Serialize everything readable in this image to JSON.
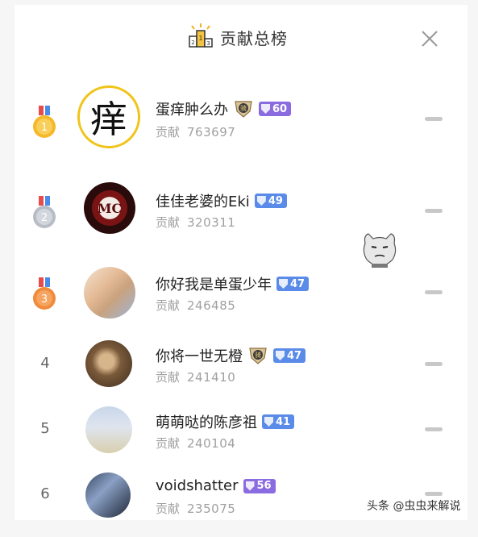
{
  "header": {
    "title": "贡献总榜"
  },
  "contribution_label": "贡献",
  "rows": [
    {
      "rank": "1",
      "name": "蛋痒肿么办",
      "has_vip": true,
      "level": "60",
      "badge_color": "#8b6be0",
      "contribution": "763697",
      "avatar_text": "痒"
    },
    {
      "rank": "2",
      "name": "佳佳老婆的Eki",
      "has_vip": false,
      "level": "49",
      "badge_color": "#5b8be8",
      "contribution": "320311",
      "avatar_text": "MC"
    },
    {
      "rank": "3",
      "name": "你好我是单蛋少年",
      "has_vip": false,
      "level": "47",
      "badge_color": "#5b8be8",
      "contribution": "246485"
    },
    {
      "rank": "4",
      "name": "你将一世无橙",
      "has_vip": true,
      "level": "47",
      "badge_color": "#5b8be8",
      "contribution": "241410"
    },
    {
      "rank": "5",
      "name": "萌萌哒的陈彦祖",
      "has_vip": false,
      "level": "41",
      "badge_color": "#5b8be8",
      "contribution": "240104"
    },
    {
      "rank": "6",
      "name": "voidshatter",
      "has_vip": false,
      "level": "56",
      "badge_color": "#8b6be0",
      "contribution": "235075"
    }
  ],
  "vip_label": "骑",
  "watermark": "头条 @虫虫来解说",
  "colors": {
    "gold": "#f5b82a",
    "silver": "#c9ccd3",
    "bronze": "#f08a3c",
    "dash": "#c8c8c8"
  }
}
